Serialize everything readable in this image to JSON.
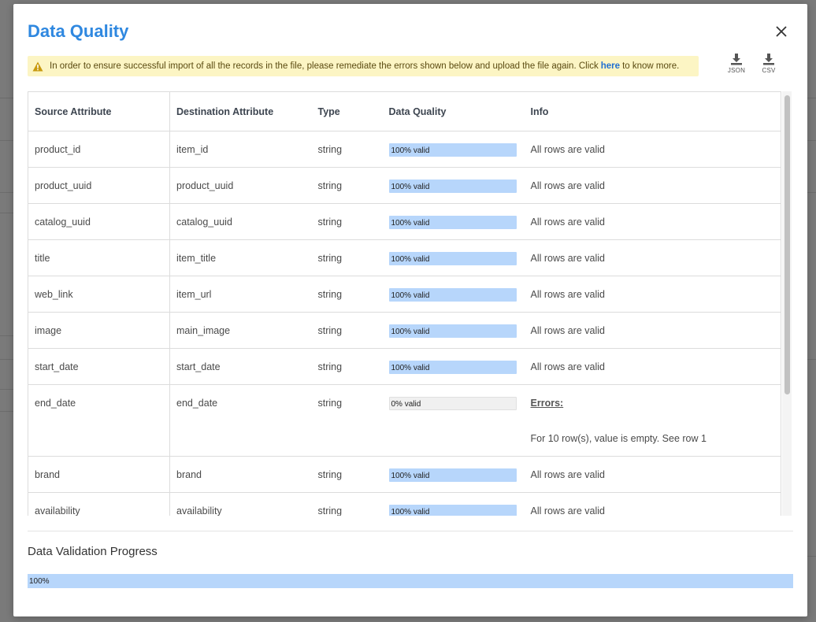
{
  "modal": {
    "title": "Data Quality",
    "alert": {
      "text_before": "In order to ensure successful import of all the records in the file, please remediate the errors shown below and upload the file again. Click",
      "link_text": "here",
      "text_after": "to know more."
    },
    "downloads": [
      {
        "label": "JSON",
        "icon": "download-icon"
      },
      {
        "label": "CSV",
        "icon": "download-icon"
      }
    ]
  },
  "table": {
    "headers": [
      "Source Attribute",
      "Destination Attribute",
      "Type",
      "Data Quality",
      "Info"
    ],
    "rows": [
      {
        "source": "product_id",
        "destination": "item_id",
        "type": "string",
        "quality": "100% valid",
        "valid_fraction": 1.0,
        "info": "All rows are valid"
      },
      {
        "source": "product_uuid",
        "destination": "product_uuid",
        "type": "string",
        "quality": "100% valid",
        "valid_fraction": 1.0,
        "info": "All rows are valid"
      },
      {
        "source": "catalog_uuid",
        "destination": "catalog_uuid",
        "type": "string",
        "quality": "100% valid",
        "valid_fraction": 1.0,
        "info": "All rows are valid"
      },
      {
        "source": "title",
        "destination": "item_title",
        "type": "string",
        "quality": "100% valid",
        "valid_fraction": 1.0,
        "info": "All rows are valid"
      },
      {
        "source": "web_link",
        "destination": "item_url",
        "type": "string",
        "quality": "100% valid",
        "valid_fraction": 1.0,
        "info": "All rows are valid"
      },
      {
        "source": "image",
        "destination": "main_image",
        "type": "string",
        "quality": "100% valid",
        "valid_fraction": 1.0,
        "info": "All rows are valid"
      },
      {
        "source": "start_date",
        "destination": "start_date",
        "type": "string",
        "quality": "100% valid",
        "valid_fraction": 1.0,
        "info": "All rows are valid"
      },
      {
        "source": "end_date",
        "destination": "end_date",
        "type": "string",
        "quality": "0% valid",
        "valid_fraction": 0.0,
        "errors_title": "Errors:",
        "info": "For 10 row(s), value is empty. See row 1"
      },
      {
        "source": "brand",
        "destination": "brand",
        "type": "string",
        "quality": "100% valid",
        "valid_fraction": 1.0,
        "info": "All rows are valid"
      },
      {
        "source": "availability",
        "destination": "availability",
        "type": "string",
        "quality": "100% valid",
        "valid_fraction": 1.0,
        "info": "All rows are valid"
      }
    ]
  },
  "progress": {
    "title": "Data Validation Progress",
    "label": "100%",
    "fraction": 1.0
  },
  "colors": {
    "title": "#2f88e0",
    "valid_bar": "#b7d6fb",
    "alert_bg": "#fcf5c4",
    "warning": "#c89a0e"
  }
}
